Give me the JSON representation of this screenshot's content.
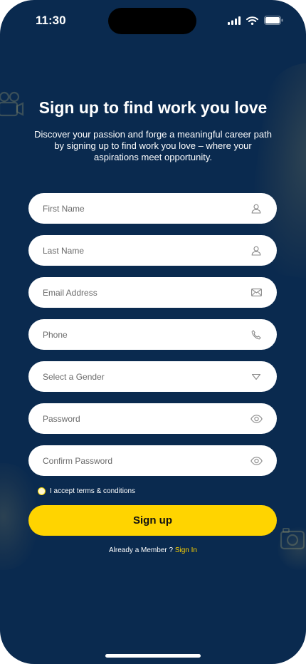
{
  "status_bar": {
    "time": "11:30",
    "icons": [
      "signal-icon",
      "wifi-icon",
      "battery-icon"
    ]
  },
  "header": {
    "title": "Sign up to find work you love",
    "subtitle": "Discover your passion and forge a meaningful career path by signing up to find work you love – where your aspirations meet opportunity."
  },
  "form": {
    "first_name": {
      "placeholder": "First Name",
      "icon": "user-icon"
    },
    "last_name": {
      "placeholder": "Last Name",
      "icon": "user-icon"
    },
    "email": {
      "placeholder": "Email Address",
      "icon": "envelope-icon"
    },
    "phone": {
      "placeholder": "Phone",
      "icon": "phone-icon"
    },
    "gender": {
      "placeholder": "Select a Gender",
      "icon": "dropdown-triangle-icon"
    },
    "password": {
      "placeholder": "Password",
      "icon": "eye-icon"
    },
    "confirm_password": {
      "placeholder": "Confirm Password",
      "icon": "eye-icon"
    },
    "terms_label": "I accept terms & conditions",
    "submit_label": "Sign up"
  },
  "footer": {
    "member_text": "Already a Member ?",
    "sign_in_label": "Sign In"
  },
  "colors": {
    "background": "#0a2a4f",
    "accent": "#ffd400",
    "field_background": "#ffffff",
    "placeholder_text": "#6a6a6a"
  }
}
